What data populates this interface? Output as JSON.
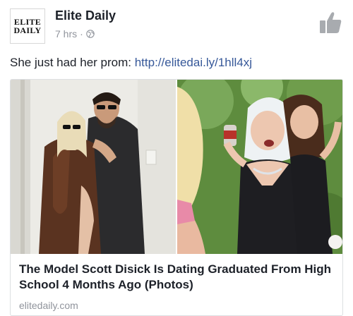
{
  "post": {
    "page_logo": {
      "line1": "ELITE",
      "line2": "DAILY"
    },
    "page_name": "Elite Daily",
    "time": "7 hrs",
    "separator": "·",
    "privacy_icon": "globe-icon",
    "like_icon": "thumbs-up-icon",
    "status_text": "She just had her prom: ",
    "link_text": "http://elitedai.ly/1hll4xj"
  },
  "link_card": {
    "title": "The Model Scott Disick Is Dating Graduated From High School 4 Months Ago (Photos)",
    "domain": "elitedaily.com"
  },
  "colors": {
    "link": "#365899",
    "meta": "#90949c",
    "like_icon": "#a8abaf"
  }
}
